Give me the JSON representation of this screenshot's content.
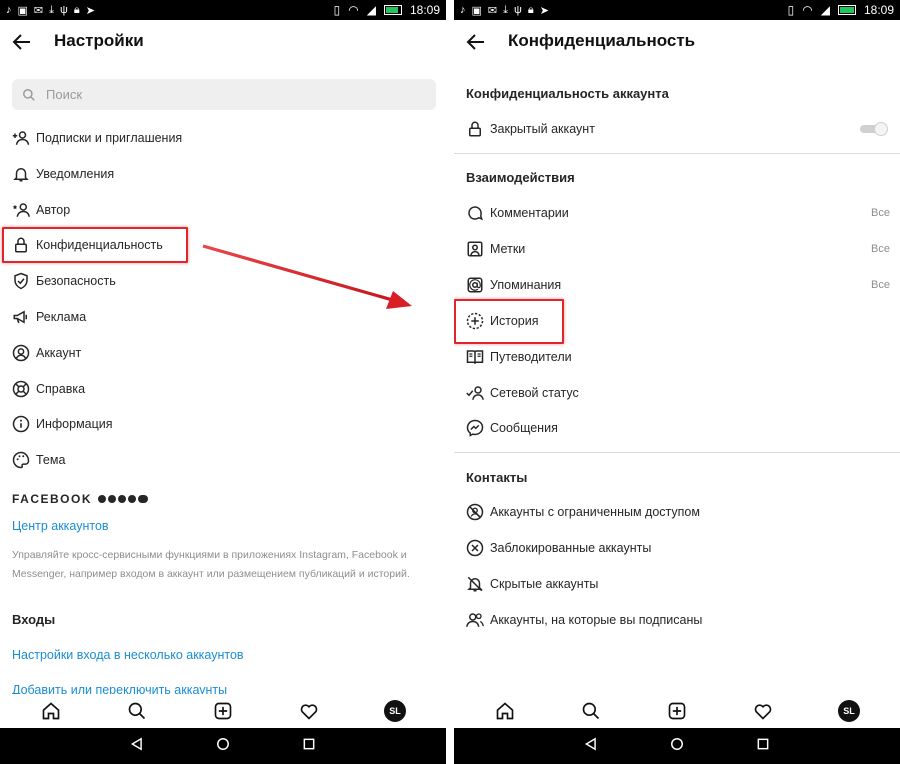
{
  "status_bar": {
    "time": "18:09"
  },
  "left": {
    "title": "Настройки",
    "search": {
      "placeholder": "Поиск"
    },
    "items": [
      {
        "label": "Подписки и приглашения",
        "icon": "add-person-icon"
      },
      {
        "label": "Уведомления",
        "icon": "bell-icon"
      },
      {
        "label": "Автор",
        "icon": "star-person-icon"
      },
      {
        "label": "Конфиденциальность",
        "icon": "lock-icon"
      },
      {
        "label": "Безопасность",
        "icon": "shield-icon"
      },
      {
        "label": "Реклама",
        "icon": "megaphone-icon"
      },
      {
        "label": "Аккаунт",
        "icon": "account-icon"
      },
      {
        "label": "Справка",
        "icon": "lifebuoy-icon"
      },
      {
        "label": "Информация",
        "icon": "info-icon"
      },
      {
        "label": "Тема",
        "icon": "palette-icon"
      }
    ],
    "facebook": {
      "brand": "FACEBOOK",
      "accounts_center": "Центр аккаунтов",
      "description": "Управляйте кросс-сервисными функциями в приложениях Instagram, Facebook и Messenger, например входом в аккаунт или размещением публикаций и историй."
    },
    "logins": {
      "heading": "Входы",
      "multi_login": "Настройки входа в несколько аккаунтов",
      "add_switch": "Добавить или переключить аккаунты"
    }
  },
  "right": {
    "title": "Конфиденциальность",
    "account_privacy": {
      "heading": "Конфиденциальность аккаунта",
      "private_account": "Закрытый аккаунт",
      "private_on": false
    },
    "interactions": {
      "heading": "Взаимодействия",
      "items": [
        {
          "label": "Комментарии",
          "value": "Все",
          "icon": "comment-icon"
        },
        {
          "label": "Метки",
          "value": "Все",
          "icon": "tag-person-icon"
        },
        {
          "label": "Упоминания",
          "value": "Все",
          "icon": "at-icon"
        },
        {
          "label": "История",
          "value": "",
          "icon": "story-add-icon"
        },
        {
          "label": "Путеводители",
          "value": "",
          "icon": "guide-icon"
        },
        {
          "label": "Сетевой статус",
          "value": "",
          "icon": "activity-status-icon"
        },
        {
          "label": "Сообщения",
          "value": "",
          "icon": "messenger-icon"
        }
      ]
    },
    "contacts": {
      "heading": "Контакты",
      "items": [
        {
          "label": "Аккаунты с ограниченным доступом",
          "icon": "restricted-icon"
        },
        {
          "label": "Заблокированные аккаунты",
          "icon": "blocked-icon"
        },
        {
          "label": "Скрытые аккаунты",
          "icon": "muted-icon"
        },
        {
          "label": "Аккаунты, на которые вы подписаны",
          "icon": "following-icon"
        }
      ]
    }
  },
  "bottom_nav": {
    "avatar_initials": "SL"
  },
  "colors": {
    "highlight": "#e0262a",
    "link": "#1a8ed2",
    "arrow": "#d81f26"
  }
}
